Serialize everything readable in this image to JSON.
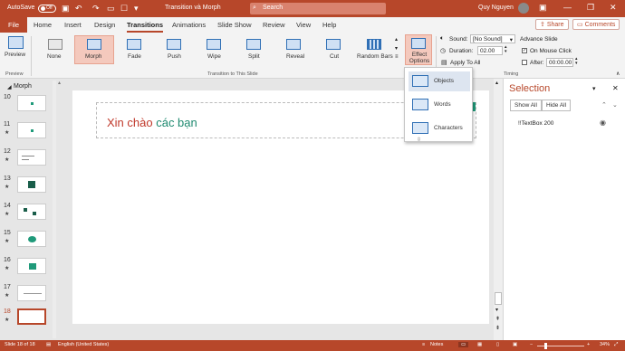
{
  "titlebar": {
    "autosave": "AutoSave",
    "autosave_state": "Off",
    "doc_title": "Transition và Morph",
    "search_placeholder": "Search",
    "user": "Quy Nguyen"
  },
  "tabs": [
    "File",
    "Home",
    "Insert",
    "Design",
    "Transitions",
    "Animations",
    "Slide Show",
    "Review",
    "View",
    "Help"
  ],
  "share_label": "Share",
  "comments_label": "Comments",
  "ribbon": {
    "preview": "Preview",
    "preview_group": "Preview",
    "transitions": [
      "None",
      "Morph",
      "Fade",
      "Push",
      "Wipe",
      "Split",
      "Reveal",
      "Cut",
      "Random Bars"
    ],
    "transition_group": "Transition to This Slide",
    "effect_options": "Effect Options",
    "sound_label": "Sound:",
    "sound_value": "[No Sound]",
    "duration_label": "Duration:",
    "duration_value": "02.00",
    "apply_all": "Apply To All",
    "advance_slide": "Advance Slide",
    "on_mouse_click": "On Mouse Click",
    "after_label": "After:",
    "after_value": "00:00.00",
    "timing_group": "Timing"
  },
  "effect_menu": [
    "Objects",
    "Words",
    "Characters"
  ],
  "section_name": "Morph",
  "slides": [
    {
      "num": "10",
      "star": ""
    },
    {
      "num": "11",
      "star": "★"
    },
    {
      "num": "12",
      "star": "★"
    },
    {
      "num": "13",
      "star": "★"
    },
    {
      "num": "14",
      "star": "★"
    },
    {
      "num": "15",
      "star": "★"
    },
    {
      "num": "16",
      "star": "★"
    },
    {
      "num": "17",
      "star": "★"
    },
    {
      "num": "18",
      "star": "★"
    }
  ],
  "slide_title": {
    "part1": "Xin chào",
    "part2": "các bạn",
    "color1": "#c0392b",
    "color2": "#1f8a70"
  },
  "selection": {
    "title": "Selection",
    "show_all": "Show All",
    "hide_all": "Hide All",
    "items": [
      "!!TextBox 200"
    ]
  },
  "status": {
    "slide_info": "Slide 18 of 18",
    "language": "English (United States)",
    "notes": "Notes",
    "zoom": "34%"
  },
  "colors": {
    "accent": "#b7472a",
    "teal": "#1f9a7a"
  }
}
